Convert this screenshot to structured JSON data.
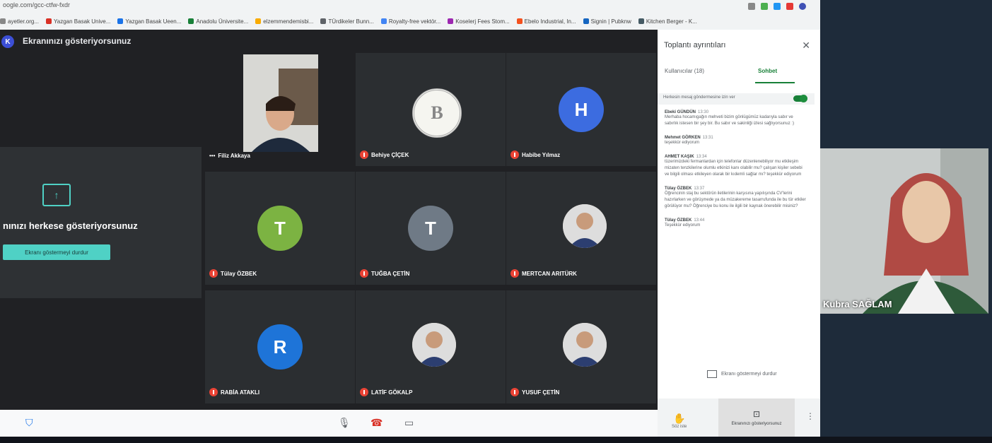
{
  "browser": {
    "url": "oogle.com/gcc-ctfw-fxdr",
    "bookmarks": [
      "ayetler.org...",
      "Yazgan Basak Unive...",
      "Yazgan Basak Ueen...",
      "Anadolu Üniversite...",
      "elzemmendemisbi...",
      "TÜrdikeler Bunn...",
      "Royalty-free vektör...",
      "Koselerj Fees Stom...",
      "Ebelo Industrial, In...",
      "Signin | Pubknw",
      "Kitchen Berger - K..."
    ]
  },
  "meet": {
    "presenting_title": "Ekranınızı gösteriyorsunuz",
    "avatar_letter": "K",
    "share_text": "nınızı herkese gösteriyorsunuz",
    "stop_button": "Ekranı göstermeyi durdur",
    "participants": [
      {
        "name": "Filiz Akkaya",
        "type": "video"
      },
      {
        "name": "Behiye ÇİÇEK",
        "type": "logo",
        "letter": "B"
      },
      {
        "name": "Habibe Yılmaz",
        "type": "letter",
        "letter": "H",
        "color": "#3c6ce0"
      },
      {
        "name": "Tülay ÖZBEK",
        "type": "letter",
        "letter": "T",
        "color": "#7cb342"
      },
      {
        "name": "TUĞBA ÇETİN",
        "type": "letter",
        "letter": "T",
        "color": "#6f7a86"
      },
      {
        "name": "MERTCAN ARITÜRK",
        "type": "photo"
      },
      {
        "name": "RABİA ATAKLI",
        "type": "letter",
        "letter": "R",
        "color": "#1e74d8"
      },
      {
        "name": "LATİF GÖKALP",
        "type": "photo"
      },
      {
        "name": "YUSUF ÇETİN",
        "type": "photo"
      }
    ]
  },
  "side": {
    "title": "Toplantı ayrıntıları",
    "tab_people": "Kullanıcılar (18)",
    "tab_chat": "Sohbet",
    "toggle_label": "Herkesin mesaj göndermesine izin ver",
    "messages": [
      {
        "author": "Ebeki GÜNDÜN",
        "time": "13:30",
        "body": "Merhaba hocamıgağın mehveti bizim gönlügümüz kadarıyla sabır ve sabırlık istesen bir şey bir. Bu sabır ve sakinliği izlesi sağlıyorsunuz :)"
      },
      {
        "author": "Mehmet GÖRKEN",
        "time": "13:31",
        "body": "teşekkür ediyorum"
      },
      {
        "author": "AHMET KAŞIK",
        "time": "13:34",
        "body": "tüzerimizdeki fermanlardan için telefonlar düzenlenebiliyor mu etkileşim mizaten tenzkilerine olumlu etkinizi kanı olabilir mu? çalışan kişiler sebebi ve bilgili olması etkileyen olarak bir kıdemli sağlar mı? teşekkür ediyorum"
      },
      {
        "author": "Tülay ÖZBEK",
        "time": "13:37",
        "body": "Öğrencinin staj bu sektörün iletilerinin karşısına yapılışında CV'lerini hazırlarken ve görüşmede ya da müzakereme tasarrufunda ile bu tür etkiler görülüyor mu? Öğrenciye bu konu ile ilgili bir kaynak önerebilir misiniz?"
      },
      {
        "author": "Tülay ÖZBEK",
        "time": "13:44",
        "body": "Teşekkür ediyorum"
      }
    ],
    "stop_share": "Ekranı göstermeyi durdur",
    "raise_hand": "Söz iste",
    "present_now": "Ekranınızı gösteriyorsunuz"
  },
  "self_view": {
    "name": "Kubra SAĞLAM"
  }
}
